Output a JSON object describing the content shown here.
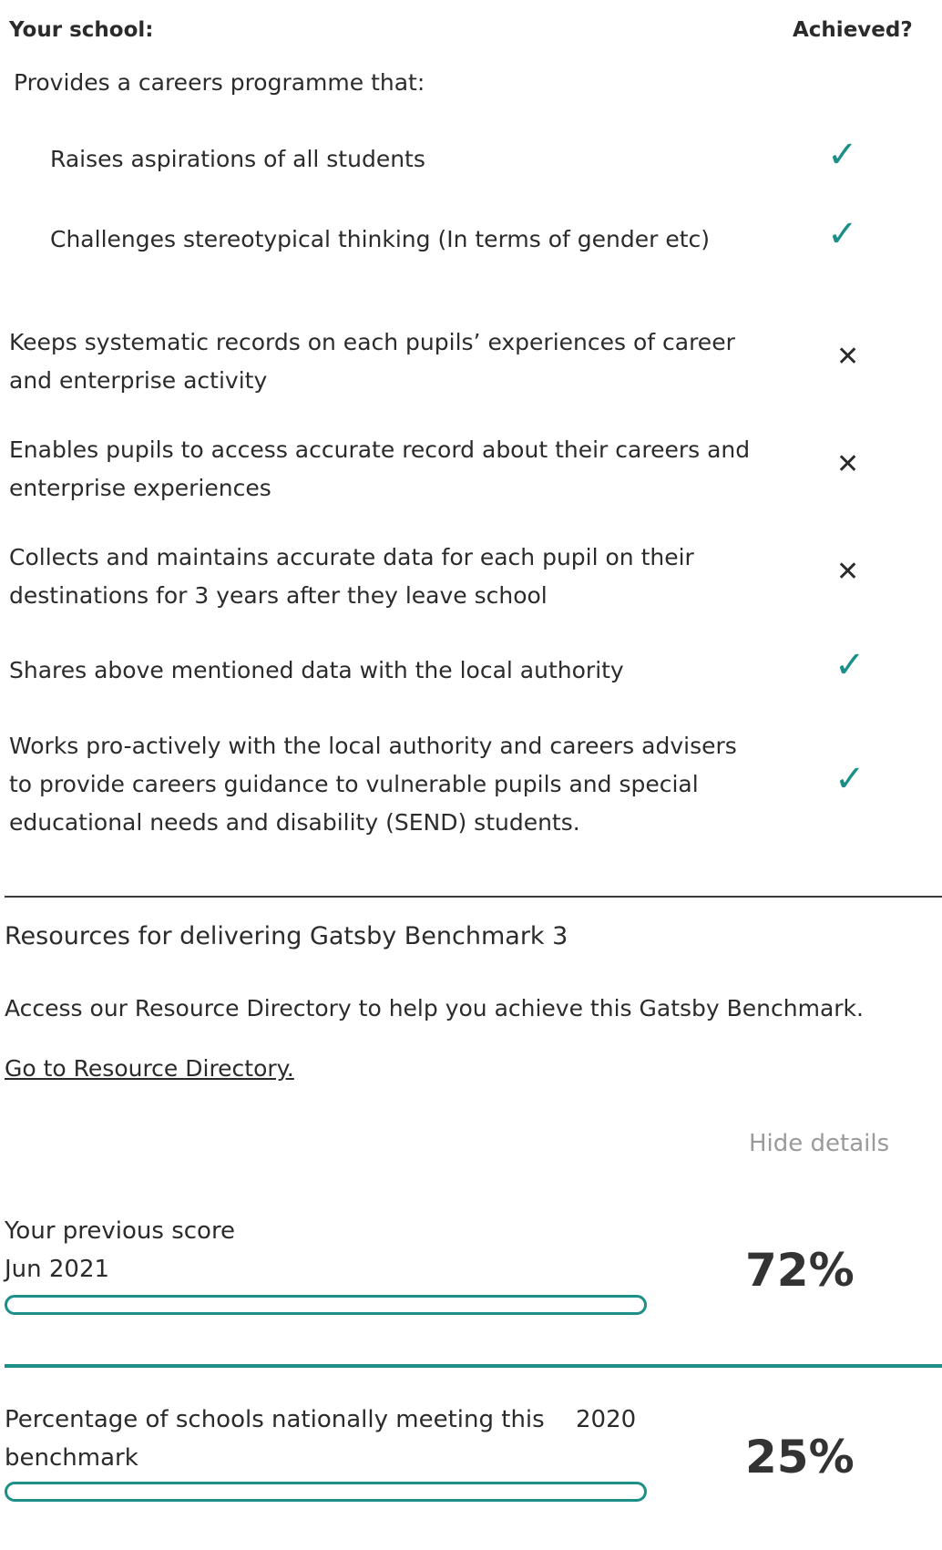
{
  "header": {
    "your_school": "Your school:",
    "achieved": "Achieved?"
  },
  "intro": "Provides a careers programme that:",
  "sub_items": [
    {
      "label": "Raises aspirations of all students",
      "achieved": true,
      "icon": "check-icon"
    },
    {
      "label": "Challenges stereotypical thinking (In terms of gender etc)",
      "achieved": true,
      "icon": "check-icon"
    }
  ],
  "items": [
    {
      "label": "Keeps systematic records on each pupils’ experiences of career and enterprise activity",
      "achieved": false,
      "icon": "cross-icon"
    },
    {
      "label": "Enables pupils to access accurate record about their careers and enterprise experiences",
      "achieved": false,
      "icon": "cross-icon"
    },
    {
      "label": "Collects and maintains accurate data for each pupil on their destinations for 3 years after they leave school",
      "achieved": false,
      "icon": "cross-icon"
    },
    {
      "label": "Shares above mentioned data with the local authority",
      "achieved": true,
      "icon": "check-icon"
    },
    {
      "label": "Works pro-actively with the local authority and careers advisers to provide careers guidance to vulnerable pupils and special educational needs and disability (SEND) students.",
      "achieved": true,
      "icon": "check-icon"
    }
  ],
  "glyphs": {
    "check": "✓",
    "cross": "✕"
  },
  "resources": {
    "title": "Resources for delivering Gatsby Benchmark 3",
    "description": "Access our Resource Directory to help you achieve this Gatsby Benchmark.",
    "link": "Go to Resource Directory."
  },
  "hide_details": "Hide details",
  "previous_score": {
    "label": "Your previous score",
    "date": "Jun 2021",
    "value": "72%",
    "fraction": 0.72
  },
  "national": {
    "label_line1": "Percentage of schools nationally meeting this",
    "label_line2": "benchmark",
    "year": "2020",
    "value": "25%",
    "fraction": 0.25
  },
  "colors": {
    "accent": "#1b8f88",
    "text": "#2b2b2b",
    "muted": "#9a9a9a"
  }
}
